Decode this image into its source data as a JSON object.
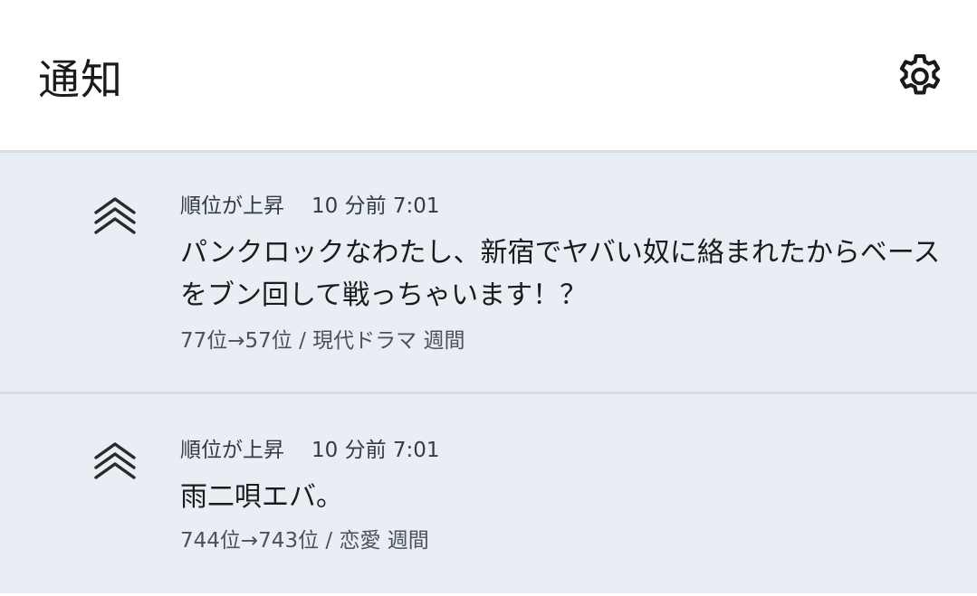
{
  "header": {
    "title": "通知",
    "settings_icon": "gear-icon"
  },
  "notifications": [
    {
      "icon": "double-chevron-up-icon",
      "type": "順位が上昇",
      "time": "10 分前 7:01",
      "headline": "パンクロックなわたし、新宿でヤバい奴に絡まれたからベースをブン回して戦っちゃいます！？",
      "detail": "77位→57位 / 現代ドラマ 週間"
    },
    {
      "icon": "double-chevron-up-icon",
      "type": "順位が上昇",
      "time": "10 分前 7:01",
      "headline": "雨二唄エバ。",
      "detail": "744位→743位 / 恋愛 週間"
    }
  ],
  "colors": {
    "item_background": "#e9eef5",
    "divider": "#d9dce1",
    "text_primary": "#1b1b1b",
    "text_secondary": "#4b5158"
  }
}
